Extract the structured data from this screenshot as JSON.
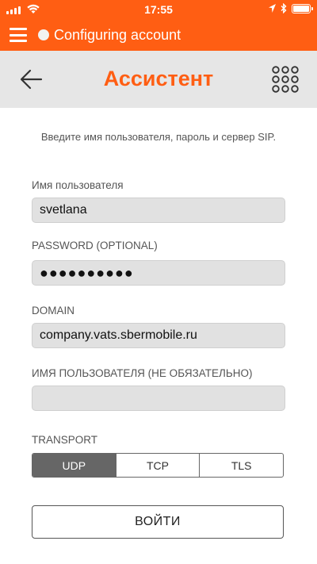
{
  "status_bar": {
    "time": "17:55"
  },
  "app_bar": {
    "title": "Configuring account"
  },
  "header": {
    "title": "Ассистент"
  },
  "instructions": "Введите имя пользователя, пароль и сервер SIP.",
  "fields": [
    {
      "label": "Имя пользователя",
      "value": "svetlana"
    },
    {
      "label": "PASSWORD (OPTIONAL)",
      "value": "●●●●●●●●●●"
    },
    {
      "label": "DOMAIN",
      "value": "company.vats.sbermobile.ru"
    },
    {
      "label": "ИМЯ ПОЛЬЗОВАТЕЛЯ (НЕ ОБЯЗАТЕЛЬНО)",
      "value": ""
    }
  ],
  "transport": {
    "label": "TRANSPORT",
    "options": [
      "UDP",
      "TCP",
      "TLS"
    ],
    "selected": "UDP"
  },
  "login_button": {
    "label": "ВОЙТИ"
  },
  "colors": {
    "accent": "#ff5e13",
    "header_bg": "#e6e6e6",
    "field_bg": "#e1e1e1",
    "selected_segment": "#666666"
  },
  "icons": [
    "signal-icon",
    "wifi-icon",
    "location-icon",
    "bluetooth-icon",
    "battery-icon",
    "menu-icon",
    "status-dot-icon",
    "back-arrow-icon",
    "dialpad-icon"
  ]
}
